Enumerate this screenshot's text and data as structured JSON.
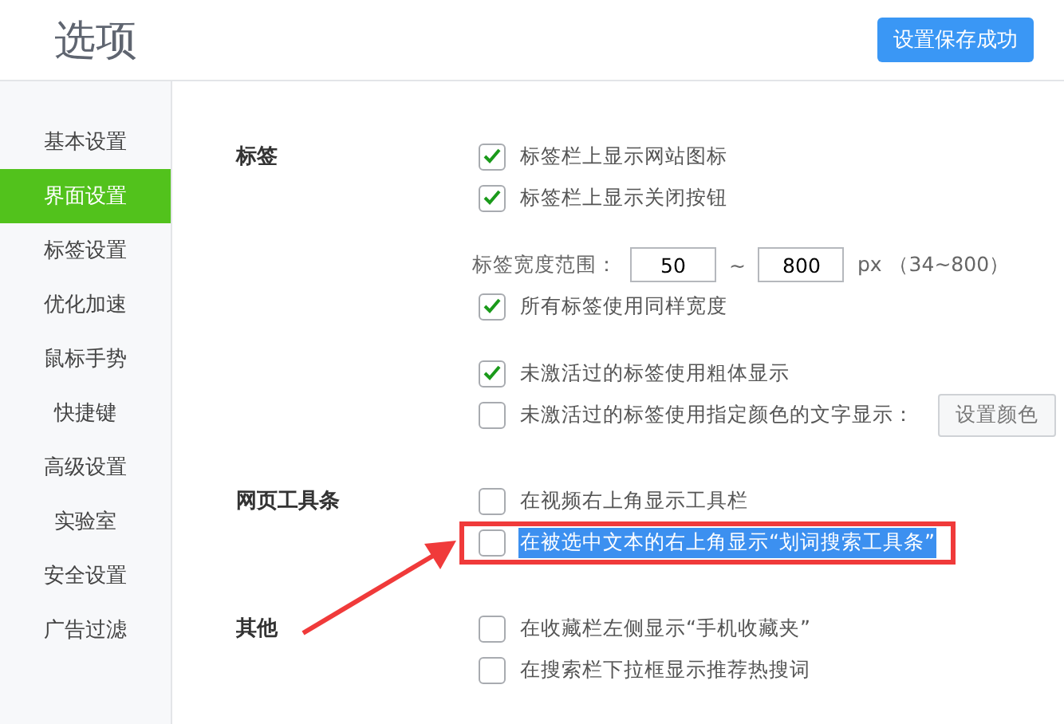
{
  "window": {
    "title": "选项"
  },
  "save_button": {
    "label": "设置保存成功"
  },
  "sidebar": {
    "items": [
      {
        "label": "基本设置",
        "selected": false
      },
      {
        "label": "界面设置",
        "selected": true
      },
      {
        "label": "标签设置",
        "selected": false
      },
      {
        "label": "优化加速",
        "selected": false
      },
      {
        "label": "鼠标手势",
        "selected": false
      },
      {
        "label": "快捷键",
        "selected": false
      },
      {
        "label": "高级设置",
        "selected": false
      },
      {
        "label": "实验室",
        "selected": false
      },
      {
        "label": "安全设置",
        "selected": false
      },
      {
        "label": "广告过滤",
        "selected": false
      }
    ]
  },
  "sections": [
    {
      "label": "标签",
      "groups": [
        [
          {
            "kind": "checkbox",
            "label": "标签栏上显示网站图标",
            "checked": true
          },
          {
            "kind": "checkbox",
            "label": "标签栏上显示关闭按钮",
            "checked": true
          }
        ],
        [
          {
            "kind": "range",
            "label": "标签宽度范围：",
            "from": "50",
            "separator": "~",
            "to": "800",
            "unit": "px （34~800）"
          },
          {
            "kind": "checkbox",
            "label": "所有标签使用同样宽度",
            "checked": true
          }
        ],
        [
          {
            "kind": "checkbox",
            "label": "未激活过的标签使用粗体显示",
            "checked": true
          },
          {
            "kind": "checkbox",
            "label": "未激活过的标签使用指定颜色的文字显示：",
            "checked": false,
            "button": "设置颜色"
          }
        ]
      ]
    },
    {
      "label": "网页工具条",
      "groups": [
        [
          {
            "kind": "checkbox",
            "label": "在视频右上角显示工具栏",
            "checked": false
          },
          {
            "kind": "checkbox",
            "label": "在被选中文本的右上角显示“划词搜索工具条”",
            "checked": false,
            "highlighted": true
          }
        ]
      ]
    },
    {
      "label": "其他",
      "groups": [
        [
          {
            "kind": "checkbox",
            "label": "在收藏栏左侧显示“手机收藏夹”",
            "checked": false
          },
          {
            "kind": "checkbox",
            "label": "在搜索栏下拉框显示推荐热搜词",
            "checked": false
          }
        ]
      ]
    }
  ]
}
